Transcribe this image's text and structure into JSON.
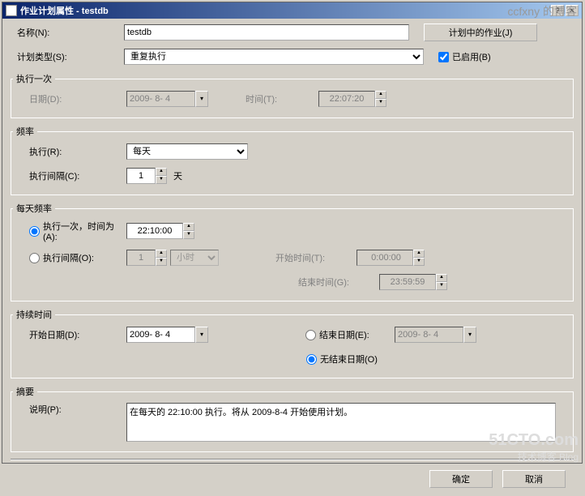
{
  "window": {
    "title": "作业计划属性 - testdb"
  },
  "watermark": {
    "top": "ccfxny 的博客",
    "bottom": "51CTO.com",
    "blog": "技术博客  Blog"
  },
  "labels": {
    "name": "名称(N):",
    "schedule_type": "计划类型(S):",
    "run_once": "执行一次",
    "date": "日期(D):",
    "time": "时间(T):",
    "frequency": "频率",
    "occurs": "执行(R):",
    "recurs_every": "执行间隔(C):",
    "days_suffix": "天",
    "daily_freq": "每天频率",
    "occurs_once_at": "执行一次，时间为(A):",
    "occurs_every": "执行间隔(O):",
    "start_time": "开始时间(T):",
    "end_time": "结束时间(G):",
    "duration": "持续时间",
    "start_date": "开始日期(D):",
    "end_date": "结束日期(E):",
    "no_end_date": "无结束日期(O)",
    "summary": "摘要",
    "description": "说明(P):",
    "jobs_in_schedule": "计划中的作业(J)",
    "enabled": "已启用(B)",
    "ok": "确定",
    "cancel": "取消"
  },
  "values": {
    "name": "testdb",
    "schedule_type": "重复执行",
    "enabled": true,
    "once_date": "2009- 8- 4",
    "once_time": "22:07:20",
    "occurs": "每天",
    "recurs_every": "1",
    "daily_once_time": "22:10:00",
    "daily_every_n": "1",
    "daily_every_unit": "小时",
    "daily_start": " 0:00:00",
    "daily_end": "23:59:59",
    "start_date": "2009- 8- 4",
    "end_date": "2009- 8- 4",
    "daily_mode": "once",
    "end_mode": "noend",
    "description": "在每天的 22:10:00 执行。将从 2009-8-4 开始使用计划。"
  }
}
